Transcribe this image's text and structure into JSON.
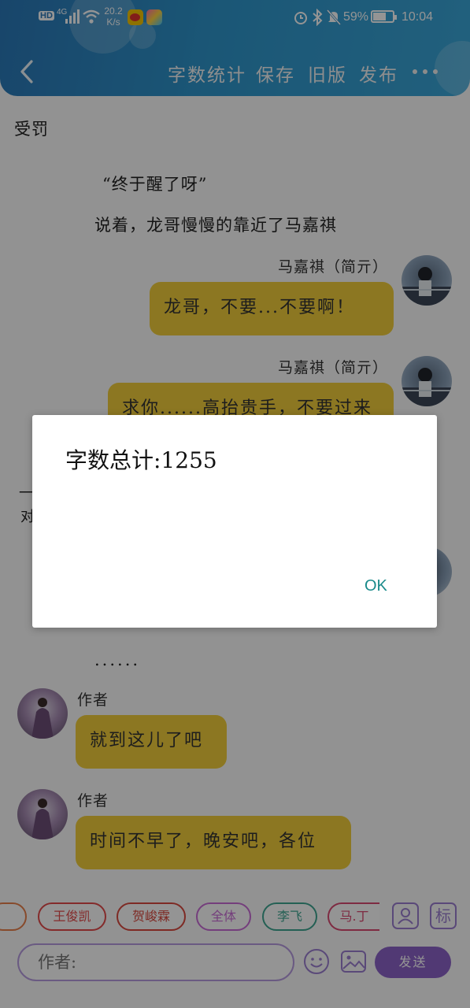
{
  "statusbar": {
    "hd": "HD",
    "network": "4G",
    "speed_value": "20.2",
    "speed_unit": "K/s",
    "battery": "59%",
    "time": "10:04"
  },
  "toolbar": {
    "word_count": "字数统计",
    "save": "保存",
    "old_version": "旧版",
    "publish": "发布"
  },
  "chat": {
    "section_title": "受罚",
    "narration_1": "“终于醒了呀”",
    "narration_2": "说着，龙哥慢慢的靠近了马嘉祺",
    "msg1_name": "马嘉祺（简亓）",
    "msg1_text": "龙哥，不要...不要啊！",
    "msg2_name": "马嘉祺（简亓）",
    "msg2_text": "求你......高抬贵手，不要过来",
    "ellipsis": "......",
    "msg3_name": "作者",
    "msg3_text": "就到这儿了吧",
    "msg4_name": "作者",
    "msg4_text": "时间不早了，晚安吧，各位"
  },
  "bottom": {
    "chips": [
      "王俊凯",
      "贺峻霖",
      "全体",
      "李飞",
      "马.丁"
    ],
    "avatar_icon_label": "标",
    "input_placeholder": "作者:",
    "send_label": "发送"
  },
  "dialog": {
    "message": "字数总计:1255",
    "ok_label": "OK"
  },
  "colors": {
    "header": "#2f96cc",
    "bubble": "#f1ce3c",
    "accent": "#8c63c9",
    "ok": "#198a8a"
  }
}
